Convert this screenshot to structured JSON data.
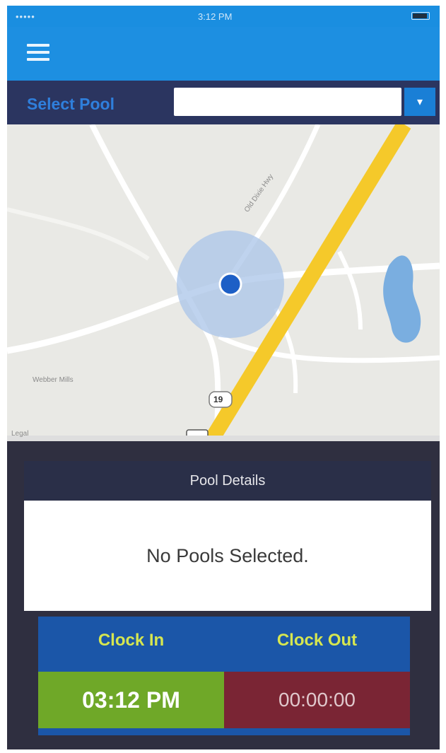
{
  "status_bar": {
    "carrier": "•••••",
    "time": "3:12 PM"
  },
  "header": {
    "menu_icon": "hamburger-menu-icon"
  },
  "pool_selector": {
    "label": "Select Pool",
    "value": "",
    "dropdown_icon": "dropdown-arrow-icon"
  },
  "map": {
    "road_labels": [
      "Old Dixie Hwy",
      "19"
    ],
    "place_labels": [
      "Webber Mills"
    ],
    "attribution": "Legal",
    "colors": {
      "highway": "#f5c92a",
      "location_halo": "#a9c4e8",
      "location_dot": "#1d5fc6",
      "water": "#7aaee0"
    }
  },
  "pool_details": {
    "title": "Pool Details",
    "empty_message": "No Pools Selected."
  },
  "clock": {
    "clock_in_label": "Clock In",
    "clock_out_label": "Clock Out",
    "clock_in_time": "03:12 PM",
    "clock_out_time": "00:00:00",
    "colors": {
      "clock_in_bg": "#6fa828",
      "clock_out_bg": "#7a2534",
      "label_color": "#d6e650"
    }
  }
}
